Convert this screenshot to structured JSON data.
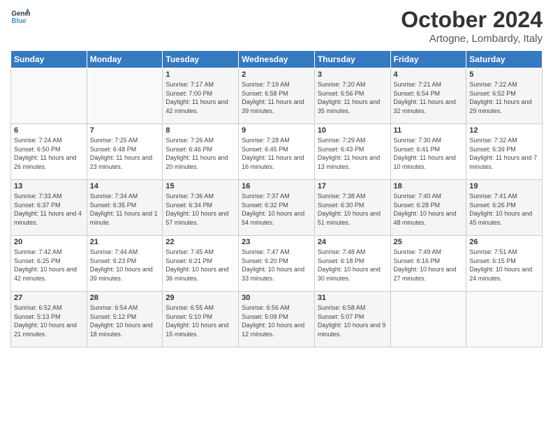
{
  "logo": {
    "line1": "General",
    "line2": "Blue"
  },
  "title": "October 2024",
  "location": "Artogne, Lombardy, Italy",
  "headers": [
    "Sunday",
    "Monday",
    "Tuesday",
    "Wednesday",
    "Thursday",
    "Friday",
    "Saturday"
  ],
  "weeks": [
    [
      {
        "day": "",
        "info": ""
      },
      {
        "day": "",
        "info": ""
      },
      {
        "day": "1",
        "info": "Sunrise: 7:17 AM\nSunset: 7:00 PM\nDaylight: 11 hours and 42 minutes."
      },
      {
        "day": "2",
        "info": "Sunrise: 7:19 AM\nSunset: 6:58 PM\nDaylight: 11 hours and 39 minutes."
      },
      {
        "day": "3",
        "info": "Sunrise: 7:20 AM\nSunset: 6:56 PM\nDaylight: 11 hours and 35 minutes."
      },
      {
        "day": "4",
        "info": "Sunrise: 7:21 AM\nSunset: 6:54 PM\nDaylight: 11 hours and 32 minutes."
      },
      {
        "day": "5",
        "info": "Sunrise: 7:22 AM\nSunset: 6:52 PM\nDaylight: 11 hours and 29 minutes."
      }
    ],
    [
      {
        "day": "6",
        "info": "Sunrise: 7:24 AM\nSunset: 6:50 PM\nDaylight: 11 hours and 26 minutes."
      },
      {
        "day": "7",
        "info": "Sunrise: 7:25 AM\nSunset: 6:48 PM\nDaylight: 11 hours and 23 minutes."
      },
      {
        "day": "8",
        "info": "Sunrise: 7:26 AM\nSunset: 6:46 PM\nDaylight: 11 hours and 20 minutes."
      },
      {
        "day": "9",
        "info": "Sunrise: 7:28 AM\nSunset: 6:45 PM\nDaylight: 11 hours and 16 minutes."
      },
      {
        "day": "10",
        "info": "Sunrise: 7:29 AM\nSunset: 6:43 PM\nDaylight: 11 hours and 13 minutes."
      },
      {
        "day": "11",
        "info": "Sunrise: 7:30 AM\nSunset: 6:41 PM\nDaylight: 11 hours and 10 minutes."
      },
      {
        "day": "12",
        "info": "Sunrise: 7:32 AM\nSunset: 6:39 PM\nDaylight: 11 hours and 7 minutes."
      }
    ],
    [
      {
        "day": "13",
        "info": "Sunrise: 7:33 AM\nSunset: 6:37 PM\nDaylight: 11 hours and 4 minutes."
      },
      {
        "day": "14",
        "info": "Sunrise: 7:34 AM\nSunset: 6:35 PM\nDaylight: 11 hours and 1 minute."
      },
      {
        "day": "15",
        "info": "Sunrise: 7:36 AM\nSunset: 6:34 PM\nDaylight: 10 hours and 57 minutes."
      },
      {
        "day": "16",
        "info": "Sunrise: 7:37 AM\nSunset: 6:32 PM\nDaylight: 10 hours and 54 minutes."
      },
      {
        "day": "17",
        "info": "Sunrise: 7:38 AM\nSunset: 6:30 PM\nDaylight: 10 hours and 51 minutes."
      },
      {
        "day": "18",
        "info": "Sunrise: 7:40 AM\nSunset: 6:28 PM\nDaylight: 10 hours and 48 minutes."
      },
      {
        "day": "19",
        "info": "Sunrise: 7:41 AM\nSunset: 6:26 PM\nDaylight: 10 hours and 45 minutes."
      }
    ],
    [
      {
        "day": "20",
        "info": "Sunrise: 7:42 AM\nSunset: 6:25 PM\nDaylight: 10 hours and 42 minutes."
      },
      {
        "day": "21",
        "info": "Sunrise: 7:44 AM\nSunset: 6:23 PM\nDaylight: 10 hours and 39 minutes."
      },
      {
        "day": "22",
        "info": "Sunrise: 7:45 AM\nSunset: 6:21 PM\nDaylight: 10 hours and 36 minutes."
      },
      {
        "day": "23",
        "info": "Sunrise: 7:47 AM\nSunset: 6:20 PM\nDaylight: 10 hours and 33 minutes."
      },
      {
        "day": "24",
        "info": "Sunrise: 7:48 AM\nSunset: 6:18 PM\nDaylight: 10 hours and 30 minutes."
      },
      {
        "day": "25",
        "info": "Sunrise: 7:49 AM\nSunset: 6:16 PM\nDaylight: 10 hours and 27 minutes."
      },
      {
        "day": "26",
        "info": "Sunrise: 7:51 AM\nSunset: 6:15 PM\nDaylight: 10 hours and 24 minutes."
      }
    ],
    [
      {
        "day": "27",
        "info": "Sunrise: 6:52 AM\nSunset: 5:13 PM\nDaylight: 10 hours and 21 minutes."
      },
      {
        "day": "28",
        "info": "Sunrise: 6:54 AM\nSunset: 5:12 PM\nDaylight: 10 hours and 18 minutes."
      },
      {
        "day": "29",
        "info": "Sunrise: 6:55 AM\nSunset: 5:10 PM\nDaylight: 10 hours and 15 minutes."
      },
      {
        "day": "30",
        "info": "Sunrise: 6:56 AM\nSunset: 5:09 PM\nDaylight: 10 hours and 12 minutes."
      },
      {
        "day": "31",
        "info": "Sunrise: 6:58 AM\nSunset: 5:07 PM\nDaylight: 10 hours and 9 minutes."
      },
      {
        "day": "",
        "info": ""
      },
      {
        "day": "",
        "info": ""
      }
    ]
  ]
}
